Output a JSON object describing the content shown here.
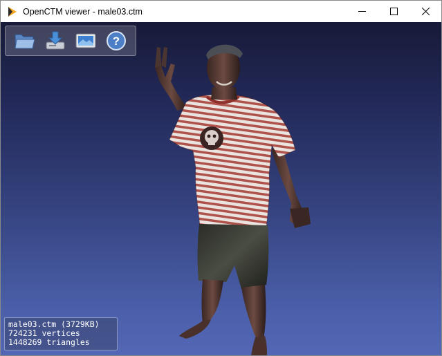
{
  "window": {
    "title": "OpenCTM viewer - male03.ctm",
    "app_icon": "play-triangle-icon",
    "controls": {
      "minimize": "minimize-icon",
      "maximize": "maximize-icon",
      "close": "close-icon"
    }
  },
  "toolbar": {
    "buttons": [
      {
        "icon": "open-folder-icon"
      },
      {
        "icon": "save-icon"
      },
      {
        "icon": "texture-icon"
      },
      {
        "icon": "help-icon"
      }
    ]
  },
  "model": {
    "name": "3d-human-model"
  },
  "info": {
    "file_line": "male03.ctm (3729KB)",
    "vertices_line": "724231 vertices",
    "triangles_line": "1448269 triangles"
  },
  "colors": {
    "viewport_top": "#171a38",
    "viewport_bottom": "#5367b6",
    "app_icon_orange": "#f5a623"
  }
}
